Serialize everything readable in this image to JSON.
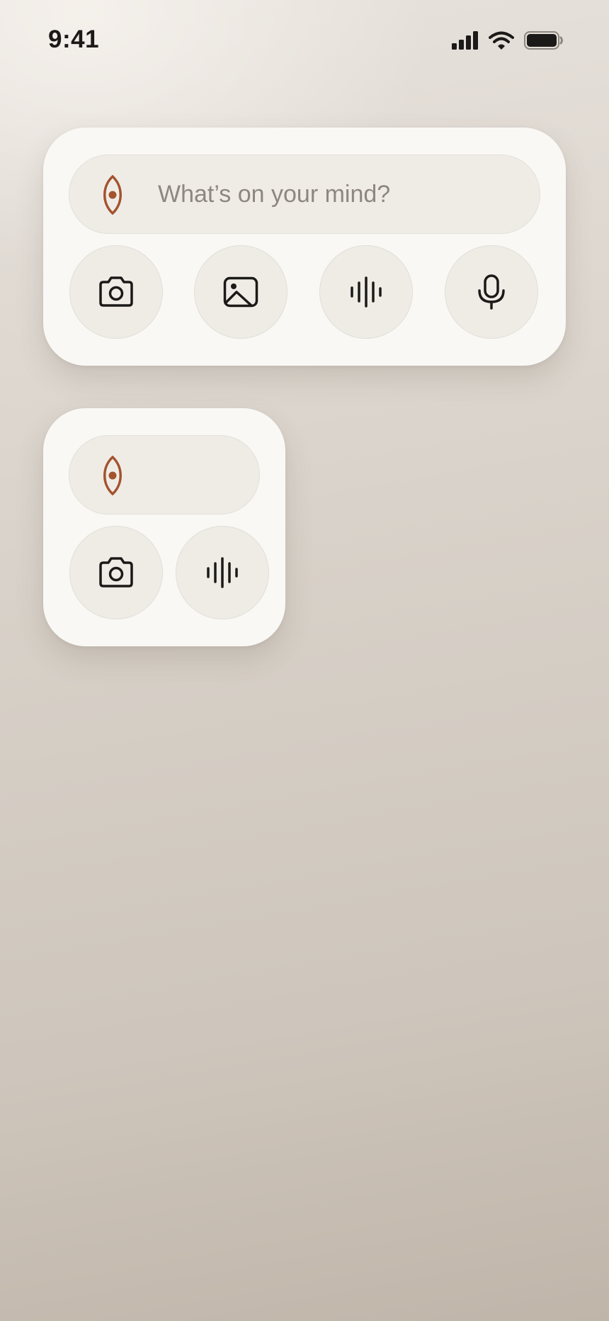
{
  "status_bar": {
    "time": "9:41",
    "icons": [
      "cellular-signal-icon",
      "wifi-icon",
      "battery-icon"
    ]
  },
  "widget_large": {
    "placeholder": "What’s on your mind?",
    "buttons": [
      {
        "name": "camera",
        "icon": "camera-icon"
      },
      {
        "name": "photo",
        "icon": "image-icon"
      },
      {
        "name": "voice",
        "icon": "waveform-icon"
      },
      {
        "name": "dictate",
        "icon": "microphone-icon"
      }
    ]
  },
  "widget_small": {
    "buttons": [
      {
        "name": "camera",
        "icon": "camera-icon"
      },
      {
        "name": "voice",
        "icon": "waveform-icon"
      }
    ]
  },
  "colors": {
    "accent": "#a3532e",
    "icon": "#1c1a18",
    "placeholder": "#8d8780",
    "widget_bg": "#f9f8f5",
    "pill_bg": "#efece6"
  }
}
